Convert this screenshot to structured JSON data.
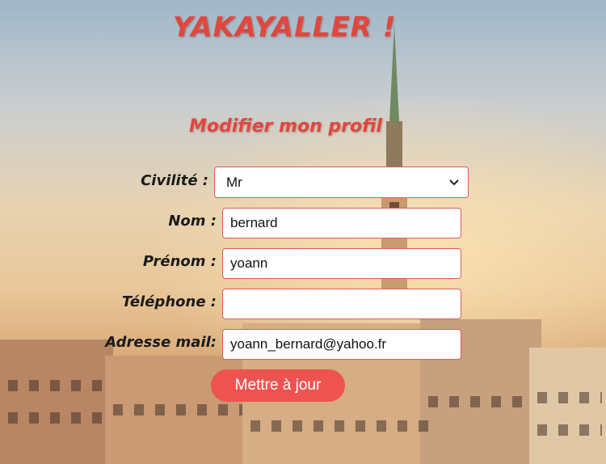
{
  "header": {
    "title": "YAKAYALLER !"
  },
  "form": {
    "heading": "Modifier mon profil",
    "civilite": {
      "label": "Civilité :",
      "value": "Mr"
    },
    "nom": {
      "label": "Nom :",
      "value": "bernard"
    },
    "prenom": {
      "label": "Prénom :",
      "value": "yoann"
    },
    "telephone": {
      "label": "Téléphone :",
      "value": ""
    },
    "email": {
      "label": "Adresse mail:",
      "value": "yoann_bernard@yahoo.fr"
    },
    "submit_label": "Mettre à jour"
  },
  "colors": {
    "accent": "#e0473f",
    "button": "#ef5350",
    "field_border": "#e25a5a"
  }
}
